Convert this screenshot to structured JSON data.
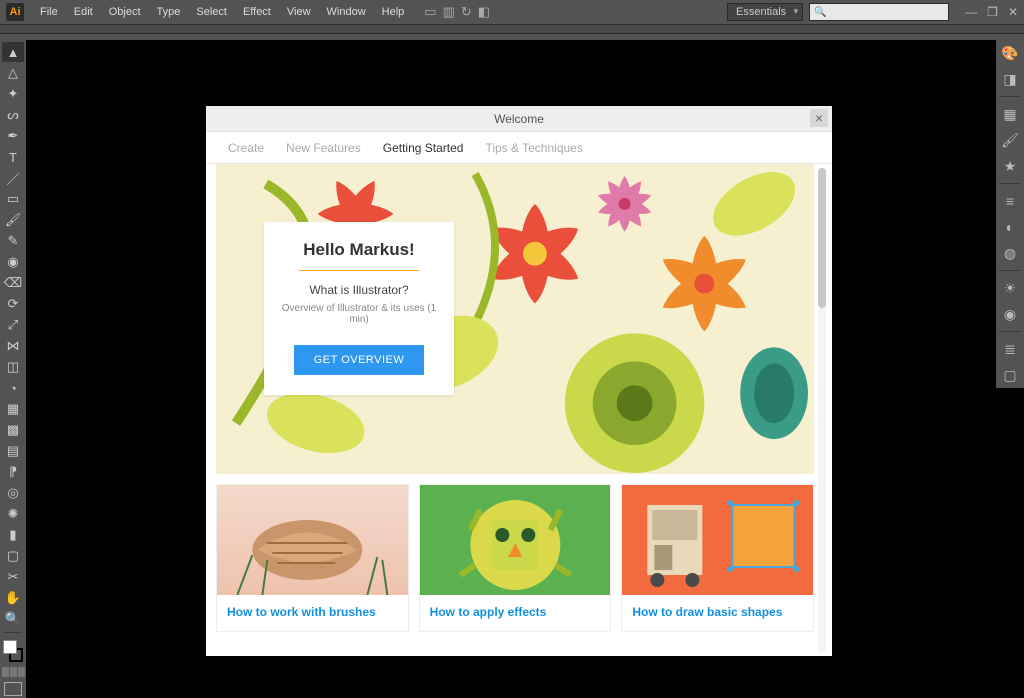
{
  "app": {
    "logo": "Ai",
    "workspace": "Essentials"
  },
  "menu": [
    "File",
    "Edit",
    "Object",
    "Type",
    "Select",
    "Effect",
    "View",
    "Window",
    "Help"
  ],
  "search": {
    "icon": "🔍"
  },
  "tools": {
    "items": [
      "selection",
      "direct-selection",
      "magic-wand",
      "lasso",
      "pen",
      "type",
      "line",
      "rectangle",
      "paintbrush",
      "pencil",
      "blob-brush",
      "eraser",
      "rotate",
      "scale",
      "width",
      "free-transform",
      "shape-builder",
      "perspective",
      "mesh",
      "gradient",
      "eyedropper",
      "blend",
      "symbol-sprayer",
      "column-graph",
      "artboard",
      "slice",
      "hand",
      "zoom"
    ]
  },
  "right_panels": [
    "color",
    "color-guide",
    "swatches",
    "brushes",
    "symbols",
    "stroke",
    "gradient",
    "transparency",
    "appearance",
    "graphic-styles",
    "layers",
    "artboards"
  ],
  "welcome": {
    "title": "Welcome",
    "tabs": [
      "Create",
      "New Features",
      "Getting Started",
      "Tips & Techniques"
    ],
    "active_tab": 2,
    "hero": {
      "greeting": "Hello Markus!",
      "question": "What is Illustrator?",
      "subtitle": "Overview of Illustrator & its uses (1 min)",
      "cta": "GET OVERVIEW"
    },
    "tutorials": [
      {
        "label": "How to work with brushes"
      },
      {
        "label": "How to apply effects"
      },
      {
        "label": "How to draw basic shapes"
      }
    ]
  }
}
